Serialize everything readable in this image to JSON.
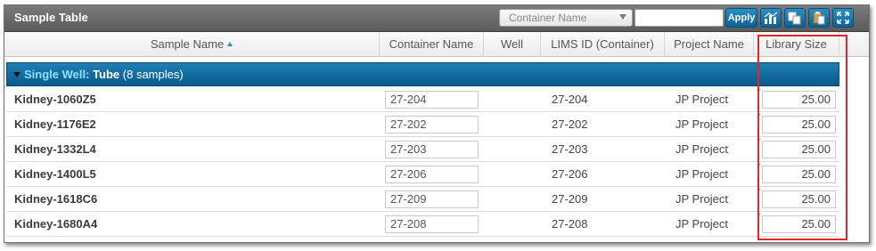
{
  "title": "Sample Table",
  "toolbar": {
    "select_value": "Container Name",
    "apply_label": "Apply",
    "buttons": [
      "chart-icon",
      "copy-icon",
      "paste-icon",
      "expand-icon"
    ]
  },
  "columns": [
    "Sample Name",
    "Container Name",
    "Well",
    "LIMS ID (Container)",
    "Project Name",
    "Library Size"
  ],
  "group": {
    "label": "Single Well:",
    "type": "Tube",
    "count": "(8 samples)"
  },
  "rows": [
    {
      "name": "Kidney-1060Z5",
      "container": "27-204",
      "lims": "27-204",
      "project": "JP Project",
      "library": "25.00"
    },
    {
      "name": "Kidney-1176E2",
      "container": "27-202",
      "lims": "27-202",
      "project": "JP Project",
      "library": "25.00"
    },
    {
      "name": "Kidney-1332L4",
      "container": "27-203",
      "lims": "27-203",
      "project": "JP Project",
      "library": "25.00"
    },
    {
      "name": "Kidney-1400L5",
      "container": "27-206",
      "lims": "27-206",
      "project": "JP Project",
      "library": "25.00"
    },
    {
      "name": "Kidney-1618C6",
      "container": "27-209",
      "lims": "27-209",
      "project": "JP Project",
      "library": "25.00"
    },
    {
      "name": "Kidney-1680A4",
      "container": "27-208",
      "lims": "27-208",
      "project": "JP Project",
      "library": "25.00"
    }
  ],
  "colors": {
    "accent": "#0c6294",
    "highlight": "#e2262a",
    "group_label": "#8fe0ff"
  }
}
